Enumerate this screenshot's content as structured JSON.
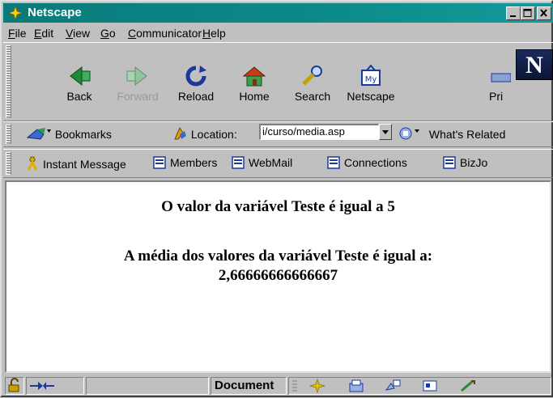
{
  "window": {
    "title": "Netscape"
  },
  "menu": {
    "items": [
      {
        "label_u": "F",
        "label_rest": "ile"
      },
      {
        "label_u": "E",
        "label_rest": "dit"
      },
      {
        "label_u": "V",
        "label_rest": "iew"
      },
      {
        "label_u": "G",
        "label_rest": "o"
      },
      {
        "label_u": "C",
        "label_rest": "ommunicator"
      },
      {
        "label_u": "H",
        "label_rest": "elp"
      }
    ]
  },
  "navigation": {
    "back": "Back",
    "forward": "Forward",
    "reload": "Reload",
    "home": "Home",
    "search": "Search",
    "netscape": "Netscape",
    "print": "Pri",
    "logo": "N"
  },
  "location_bar": {
    "bookmarks": "Bookmarks",
    "location_label": "Location:",
    "url": "i/curso/media.asp",
    "whats_related": "What's Related"
  },
  "personal_bar": {
    "items": [
      "Instant Message",
      "Members",
      "WebMail",
      "Connections",
      "BizJo"
    ]
  },
  "page": {
    "line1": "O valor da variável Teste é igual a 5",
    "line2": "A média dos valores da variável Teste é igual a:",
    "line3": "2,66666666666667"
  },
  "status": {
    "text": "Document"
  },
  "colors": {
    "titlebar": "#0a7a7a",
    "chrome": "#c0c0c0",
    "content_bg": "#ffffff"
  }
}
